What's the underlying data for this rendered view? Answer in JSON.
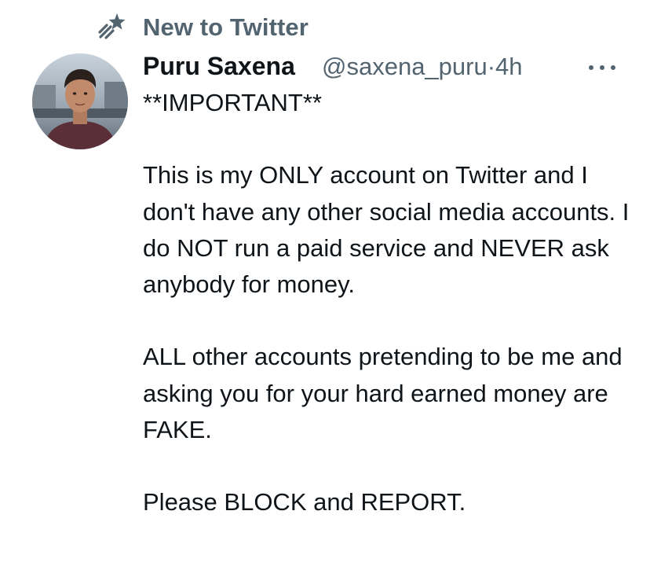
{
  "social_context": {
    "label": "New to Twitter",
    "icon": "shooting-star-icon"
  },
  "author": {
    "name": "Puru Saxena",
    "handle": "@saxena_puru",
    "separator": "·",
    "time": "4h",
    "avatar": "avatar-photo"
  },
  "more_icon": "more-horizontal-icon",
  "tweet": {
    "paragraphs": [
      "**IMPORTANT**",
      "This is my ONLY account on Twitter and I don't have any other social media accounts. I do NOT run a paid service and NEVER ask anybody for money.",
      "ALL other accounts pretending to be me and asking you for your hard earned money are FAKE.",
      "Please BLOCK and REPORT."
    ]
  },
  "colors": {
    "primary_text": "#0f1419",
    "secondary_text": "#536471",
    "background": "#ffffff"
  }
}
